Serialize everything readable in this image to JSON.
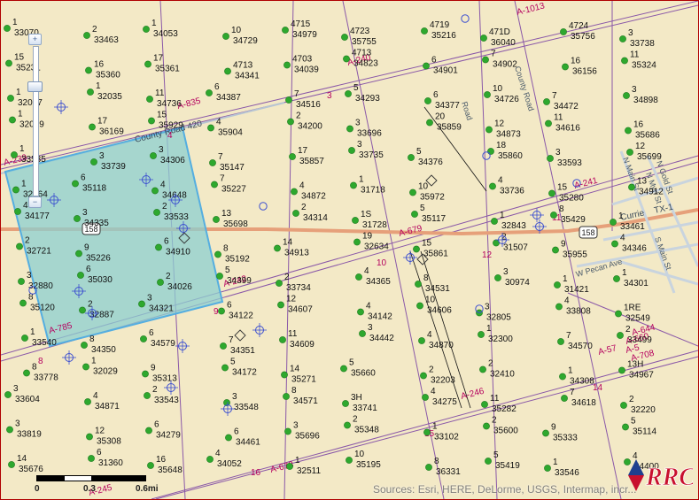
{
  "map": {
    "attribution": "Sources: Esri, HERE, DeLorme, USGS, Intermap, incr...",
    "colors": {
      "background": "#f3e9c6",
      "survey_line": "#8a58a8",
      "highway": "#e6a07a",
      "well": "#2ea82e",
      "permit": "#3c4fd0",
      "polygon_fill": "#8ccfd0",
      "polygon_stroke": "#55aee0",
      "abstract_label": "#b5005e"
    },
    "controls": {
      "zoom_in_label": "+",
      "zoom_out_label": "−",
      "zoom_level": 0.27
    },
    "scale": {
      "ticks": [
        "0",
        "0.3",
        "0.6mi"
      ]
    },
    "highway_shield": "158",
    "road_labels": {
      "county_road": "County Road 420",
      "currie": "Currie",
      "tx158": "TX-1",
      "pecan": "W Pecan Ave",
      "s_main": "S Main St",
      "n_main": "N Main St",
      "n_gold": "N Gold St",
      "n_myrl": "N Myrl St",
      "county_road_east": "County Road",
      "road_ne": "Road"
    },
    "abstract_labels": [
      "A-1013",
      "A-240",
      "A-835",
      "A-239",
      "A-679",
      "A-241",
      "A-242",
      "A-785",
      "A-678",
      "A-245",
      "A-246",
      "A-644",
      "A-660",
      "A-5",
      "A-708",
      "A-57"
    ],
    "section_numbers": [
      "3",
      "4",
      "9",
      "8",
      "10",
      "11",
      "12",
      "14",
      "15",
      "16"
    ],
    "logo_text": "RRC",
    "wells": [
      [
        "1",
        "33070"
      ],
      [
        "2",
        "33463"
      ],
      [
        "1",
        "34053"
      ],
      [
        "10",
        "34729"
      ],
      [
        "4715",
        "34979"
      ],
      [
        "4723",
        "35755"
      ],
      [
        "4719",
        "35216"
      ],
      [
        "471D",
        "36040"
      ],
      [
        "4724",
        "35756"
      ],
      [
        "3",
        "33738"
      ],
      [
        "15",
        "35231"
      ],
      [
        "16",
        "35360"
      ],
      [
        "17",
        "35361"
      ],
      [
        "4713",
        "34341"
      ],
      [
        "4703",
        "34039"
      ],
      [
        "4713",
        "34823"
      ],
      [
        "6",
        "34901"
      ],
      [
        "7",
        "34902"
      ],
      [
        "16",
        "36156"
      ],
      [
        "11",
        "35324"
      ],
      [
        "1",
        "32067"
      ],
      [
        "1",
        "32035"
      ],
      [
        "11",
        "34736"
      ],
      [
        "6",
        "34387"
      ],
      [
        "7",
        "34516"
      ],
      [
        "5",
        "34293"
      ],
      [
        "6",
        "34377"
      ],
      [
        "10",
        "34726"
      ],
      [
        "7",
        "34472"
      ],
      [
        "3",
        "34898"
      ],
      [
        "1",
        "32039"
      ],
      [
        "17",
        "36169"
      ],
      [
        "15",
        "35929"
      ],
      [
        "4",
        "35904"
      ],
      [
        "2",
        "34200"
      ],
      [
        "3",
        "33696"
      ],
      [
        "20",
        "35859"
      ],
      [
        "12",
        "34873"
      ],
      [
        "11",
        "34616"
      ],
      [
        "16",
        "35686"
      ],
      [
        "1",
        "33535"
      ],
      [
        "3",
        "33739"
      ],
      [
        "3",
        "34306"
      ],
      [
        "7",
        "35147"
      ],
      [
        "17",
        "35857"
      ],
      [
        "3",
        "33735"
      ],
      [
        "5",
        "34376"
      ],
      [
        "18",
        "35860"
      ],
      [
        "3",
        "33593"
      ],
      [
        "12",
        "35699"
      ],
      [
        "1",
        "32864"
      ],
      [
        "6",
        "35118"
      ],
      [
        "4",
        "34648"
      ],
      [
        "7",
        "35227"
      ],
      [
        "4",
        "34872"
      ],
      [
        "1",
        "31718"
      ],
      [
        "10",
        "35972"
      ],
      [
        "4",
        "33736"
      ],
      [
        "15",
        "35280"
      ],
      [
        "13",
        "34912"
      ],
      [
        "4",
        "34177"
      ],
      [
        "3",
        "34335"
      ],
      [
        "2",
        "33533"
      ],
      [
        "13",
        "35698"
      ],
      [
        "2",
        "34314"
      ],
      [
        "1S",
        "31728"
      ],
      [
        "5",
        "35117"
      ],
      [
        "1",
        "32843"
      ],
      [
        "8",
        "35429"
      ],
      [
        "1",
        "33461"
      ],
      [
        "2",
        "32721"
      ],
      [
        "9",
        "35226"
      ],
      [
        "6",
        "34910"
      ],
      [
        "8",
        "35192"
      ],
      [
        "14",
        "34913"
      ],
      [
        "19",
        "32634"
      ],
      [
        "15",
        "35861"
      ],
      [
        "2",
        "31507"
      ],
      [
        "9",
        "35955"
      ],
      [
        "4",
        "34346"
      ],
      [
        "3",
        "32880"
      ],
      [
        "6",
        "35030"
      ],
      [
        "2",
        "34026"
      ],
      [
        "5",
        "34399"
      ],
      [
        "2",
        "33734"
      ],
      [
        "4",
        "34365"
      ],
      [
        "8",
        "34531"
      ],
      [
        "3",
        "30974"
      ],
      [
        "1",
        "31421"
      ],
      [
        "1",
        "34301"
      ],
      [
        "8",
        "35120"
      ],
      [
        "2",
        "32887"
      ],
      [
        "3",
        "34321"
      ],
      [
        "6",
        "34122"
      ],
      [
        "12",
        "34607"
      ],
      [
        "4",
        "34142"
      ],
      [
        "10",
        "34606"
      ],
      [
        "3",
        "32805"
      ],
      [
        "4",
        "33808"
      ],
      [
        "1RE",
        "32549"
      ],
      [
        "1",
        "33540"
      ],
      [
        "8",
        "34350"
      ],
      [
        "6",
        "34579"
      ],
      [
        "7",
        "34351"
      ],
      [
        "11",
        "34609"
      ],
      [
        "3",
        "34442"
      ],
      [
        "4",
        "34870"
      ],
      [
        "1",
        "32300"
      ],
      [
        "7",
        "34570"
      ],
      [
        "2",
        "33499"
      ],
      [
        "8",
        "33778"
      ],
      [
        "1",
        "32029"
      ],
      [
        "9",
        "35313"
      ],
      [
        "5",
        "34172"
      ],
      [
        "14",
        "35271"
      ],
      [
        "5",
        "35660"
      ],
      [
        "2",
        "32203"
      ],
      [
        "2",
        "32410"
      ],
      [
        "1",
        "34308"
      ],
      [
        "13H",
        "34967"
      ],
      [
        "3",
        "33604"
      ],
      [
        "4",
        "34871"
      ],
      [
        "2",
        "33543"
      ],
      [
        "3",
        "33548"
      ],
      [
        "8",
        "34571"
      ],
      [
        "3H",
        "33741"
      ],
      [
        "4",
        "34275"
      ],
      [
        "11",
        "35282"
      ],
      [
        "7",
        "34618"
      ],
      [
        "2",
        "32220"
      ],
      [
        "3",
        "33819"
      ],
      [
        "12",
        "35308"
      ],
      [
        "6",
        "34279"
      ],
      [
        "6",
        "34461"
      ],
      [
        "3",
        "35696"
      ],
      [
        "2",
        "35348"
      ],
      [
        "1",
        "33102"
      ],
      [
        "2",
        "35600"
      ],
      [
        "9",
        "35333"
      ],
      [
        "5",
        "35114"
      ],
      [
        "14",
        "35676"
      ],
      [
        "6",
        "31360"
      ],
      [
        "16",
        "35648"
      ],
      [
        "4",
        "34052"
      ],
      [
        "1",
        "32511"
      ],
      [
        "10",
        "35195"
      ],
      [
        "8",
        "36331"
      ],
      [
        "5",
        "35419"
      ],
      [
        "1",
        "33546"
      ],
      [
        "4",
        "34400"
      ]
    ]
  }
}
